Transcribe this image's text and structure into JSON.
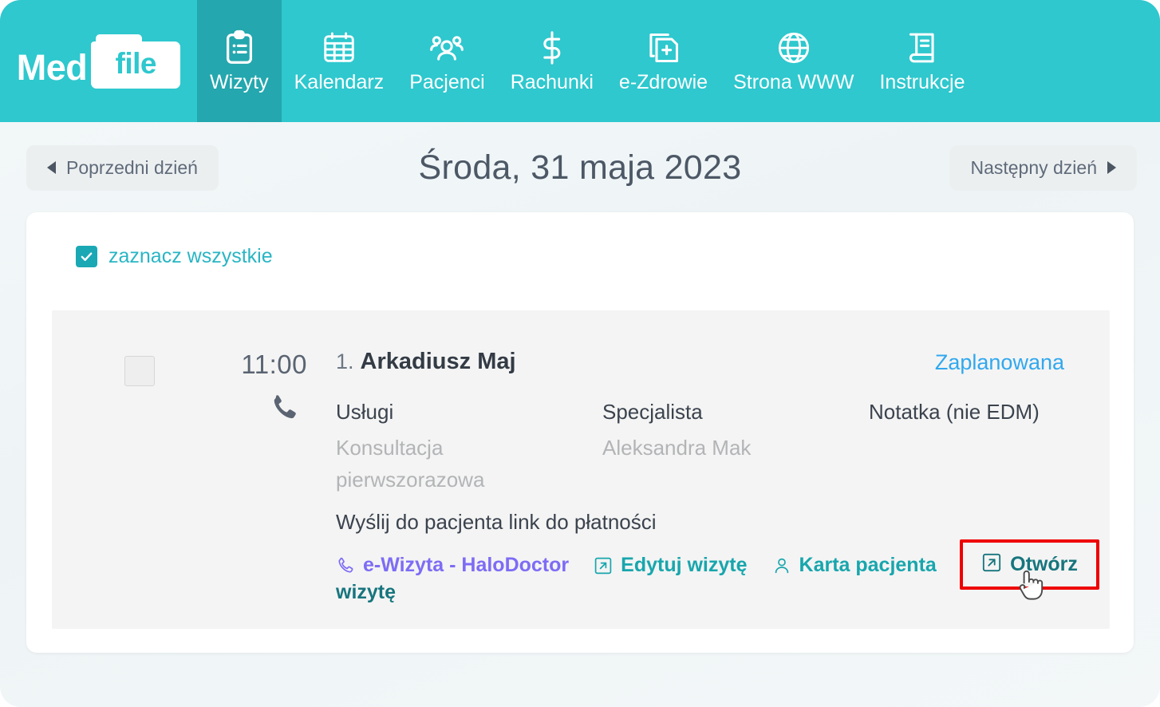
{
  "brand": {
    "logo_primary": "Med",
    "logo_secondary": "file",
    "header_color": "#2ec8ce",
    "active_tab_color": "#24a7ae"
  },
  "nav": {
    "items": [
      {
        "label": "Wizyty",
        "icon": "clipboard-list-icon",
        "active": true
      },
      {
        "label": "Kalendarz",
        "icon": "calendar-icon",
        "active": false
      },
      {
        "label": "Pacjenci",
        "icon": "users-icon",
        "active": false
      },
      {
        "label": "Rachunki",
        "icon": "dollar-icon",
        "active": false
      },
      {
        "label": "e-Zdrowie",
        "icon": "medical-file-icon",
        "active": false
      },
      {
        "label": "Strona WWW",
        "icon": "globe-icon",
        "active": false
      },
      {
        "label": "Instrukcje",
        "icon": "book-icon",
        "active": false
      }
    ]
  },
  "datebar": {
    "prev_label": "Poprzedni dzień",
    "title": "Środa, 31 maja 2023",
    "next_label": "Następny dzień"
  },
  "list": {
    "select_all_label": "zaznacz wszystkie",
    "select_all_checked": true
  },
  "appointment": {
    "checked": false,
    "time": "11:00",
    "channel_icon": "phone-icon",
    "index": "1.",
    "patient_name": "Arkadiusz Maj",
    "status": "Zaplanowana",
    "status_color": "#31a8ee",
    "columns": {
      "services_header": "Usługi",
      "services_value": "Konsultacja pierwszorazowa",
      "specialist_header": "Specjalista",
      "specialist_value": "Aleksandra Mak",
      "note_header": "Notatka (nie EDM)"
    },
    "payment_link_text": "Wyślij do pacjenta link do płatności",
    "actions": [
      {
        "label": "e-Wizyta - HaloDoctor",
        "icon": "phone-outline-icon",
        "color": "#7d6cf5"
      },
      {
        "label": "Edytuj wizytę",
        "icon": "external-link-icon",
        "color": "#18a6ad"
      },
      {
        "label": "Karta pacjenta",
        "icon": "person-icon",
        "color": "#18a6ad"
      },
      {
        "label": "Otwórz",
        "icon": "external-link-icon",
        "color": "#17757e"
      }
    ],
    "wrapped_word": "wizytę",
    "highlight": {
      "target": "Otwórz",
      "color": "#ee0000"
    }
  }
}
